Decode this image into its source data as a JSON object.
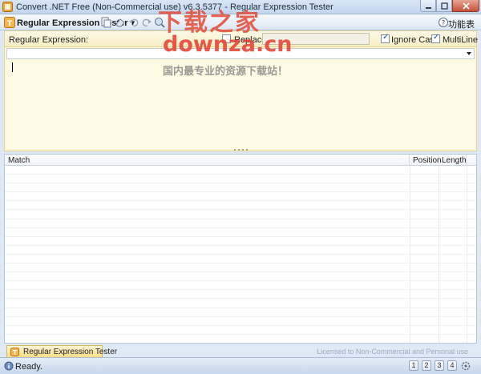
{
  "window": {
    "title": "Convert .NET Free (Non-Commercial use) v6.3.5377 - Regular Expression Tester",
    "controls": [
      "minimize-icon",
      "maximize-icon",
      "close-icon"
    ]
  },
  "toolbar": {
    "tool_menu_label": "Regular Expression Tester ▾",
    "functions_label": "功能表 ▾"
  },
  "regex_panel": {
    "label": "Regular Expression:",
    "replace_label": "Replace",
    "replace_checked": false,
    "ignore_case_label": "Ignore Case",
    "ignore_case_checked": true,
    "multiline_label": "MultiLine",
    "multiline_checked": true,
    "replace_value": "",
    "pattern_value": "",
    "input_text": ""
  },
  "results": {
    "columns": [
      "Match",
      "Position",
      "Length"
    ],
    "rows": []
  },
  "tabs": [
    {
      "label": "Regular Expression Tester",
      "active": true
    }
  ],
  "footer": {
    "license_text": "Licensed to Non-Commercial and Personal use",
    "status_text": "Ready.",
    "status_buttons": [
      "1",
      "2",
      "3",
      "4"
    ]
  },
  "watermark": {
    "line1": "下载之家",
    "line2": "downza.cn",
    "line3": "国内最专业的资源下载站！"
  },
  "colors": {
    "panel_bg": "#fdf8d8",
    "accent": "#f9dd86",
    "watermark": "#e0503c"
  }
}
